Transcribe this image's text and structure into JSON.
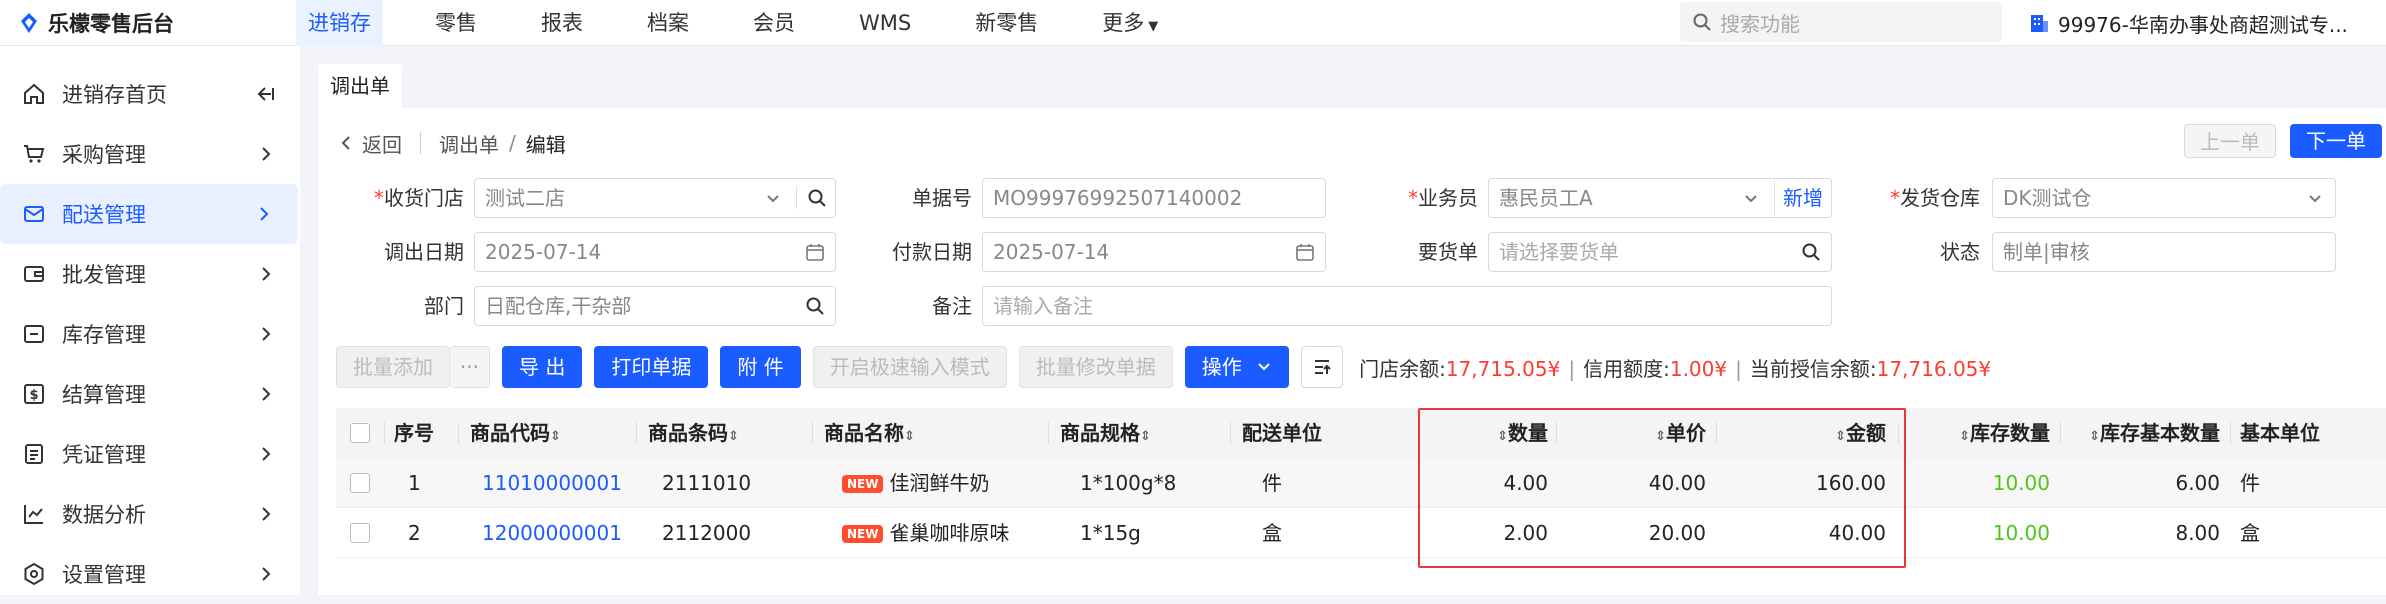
{
  "app": {
    "title": "乐檬零售后台"
  },
  "nav": [
    "进销存",
    "零售",
    "报表",
    "档案",
    "会员",
    "WMS",
    "新零售",
    "更多"
  ],
  "search": {
    "placeholder": "搜索功能"
  },
  "org": {
    "name": "99976-华南办事处商超测试专..."
  },
  "sidebar": {
    "home": "进销存首页",
    "items": [
      "采购管理",
      "配送管理",
      "批发管理",
      "库存管理",
      "结算管理",
      "凭证管理",
      "数据分析",
      "设置管理"
    ]
  },
  "tab": "调出单",
  "breadcrumb": {
    "back": "返回",
    "parent": "调出单",
    "current": "编辑"
  },
  "pager": {
    "prev": "上一单",
    "next": "下一单"
  },
  "form": {
    "store_label": "收货门店",
    "store_value": "测试二店",
    "docno_label": "单据号",
    "docno_value": "MO99976992507140002",
    "staff_label": "业务员",
    "staff_value": "惠民员工A",
    "staff_add": "新增",
    "warehouse_label": "发货仓库",
    "warehouse_value": "DK测试仓",
    "outdate_label": "调出日期",
    "outdate_value": "2025-07-14",
    "paydate_label": "付款日期",
    "paydate_value": "2025-07-14",
    "order_label": "要货单",
    "order_placeholder": "请选择要货单",
    "status_label": "状态",
    "status_value": "制单|审核",
    "dept_label": "部门",
    "dept_value": "日配仓库,干杂部",
    "remark_label": "备注",
    "remark_placeholder": "请输入备注"
  },
  "toolbar": {
    "batch_add": "批量添加",
    "more": "···",
    "export": "导 出",
    "print": "打印单据",
    "attach": "附 件",
    "quick_input": "开启极速输入模式",
    "batch_edit": "批量修改单据",
    "ops": "操作"
  },
  "balances": {
    "store_label": "门店余额:",
    "store_value": "17,715.05¥",
    "credit_label": "信用额度:",
    "credit_value": "1.00¥",
    "current_label": "当前授信余额:",
    "current_value": "17,716.05¥"
  },
  "table": {
    "headers": {
      "seq": "序号",
      "code": "商品代码",
      "barcode": "商品条码",
      "name": "商品名称",
      "spec": "商品规格",
      "unit": "配送单位",
      "qty": "数量",
      "price": "单价",
      "amount": "金额",
      "stock": "库存数量",
      "stock_base": "库存基本数量",
      "base_unit": "基本单位"
    },
    "rows": [
      {
        "seq": "1",
        "code": "11010000001",
        "barcode": "2111010",
        "badge": "NEW",
        "name": "佳润鲜牛奶",
        "spec": "1*100g*8",
        "unit": "件",
        "qty": "4.00",
        "price": "40.00",
        "amount": "160.00",
        "stock": "10.00",
        "stock_base": "6.00",
        "base_unit": "件"
      },
      {
        "seq": "2",
        "code": "12000000001",
        "barcode": "2112000",
        "badge": "NEW",
        "name": "雀巢咖啡原味",
        "spec": "1*15g",
        "unit": "盒",
        "qty": "2.00",
        "price": "20.00",
        "amount": "40.00",
        "stock": "10.00",
        "stock_base": "8.00",
        "base_unit": "盒"
      }
    ]
  }
}
